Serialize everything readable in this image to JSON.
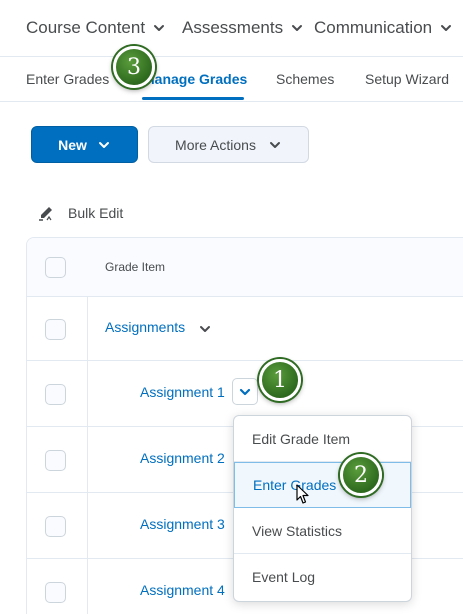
{
  "top_nav": [
    {
      "label": "Course Content"
    },
    {
      "label": "Assessments"
    },
    {
      "label": "Communication"
    }
  ],
  "tabs": [
    {
      "label": "Enter Grades",
      "active": false
    },
    {
      "label": "Manage Grades",
      "active": true
    },
    {
      "label": "Schemes",
      "active": false
    },
    {
      "label": "Setup Wizard",
      "active": false
    }
  ],
  "toolbar": {
    "new_label": "New",
    "more_actions_label": "More Actions",
    "bulk_edit_label": "Bulk Edit"
  },
  "table": {
    "column_header": "Grade Item",
    "category": "Assignments",
    "items": [
      "Assignment 1",
      "Assignment 2",
      "Assignment 3",
      "Assignment 4"
    ]
  },
  "context_menu": {
    "items": [
      "Edit Grade Item",
      "Enter Grades",
      "View Statistics",
      "Event Log"
    ],
    "highlighted": "Enter Grades"
  },
  "callouts": [
    "1",
    "2",
    "3"
  ],
  "colors": {
    "accent": "#006fbf",
    "badge_green": "#3a7d28",
    "border": "#e3e9f1"
  }
}
